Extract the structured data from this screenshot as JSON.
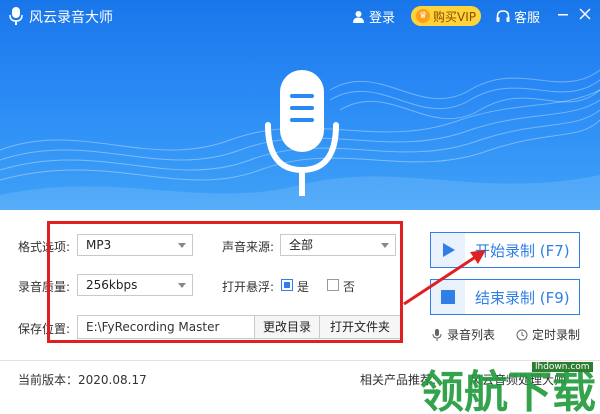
{
  "titlebar": {
    "app_title": "风云录音大师",
    "login_label": "登录",
    "vip_label": "购买VIP",
    "service_label": "客服"
  },
  "settings": {
    "format_label": "格式选项:",
    "format_value": "MP3",
    "source_label": "声音来源:",
    "source_value": "全部",
    "quality_label": "录音质量:",
    "quality_value": "256kbps",
    "float_label": "打开悬浮:",
    "float_yes": "是",
    "float_no": "否",
    "float_selected": "是",
    "save_label": "保存位置:",
    "save_path": "E:\\FyRecording Master",
    "change_dir_label": "更改目录",
    "open_folder_label": "打开文件夹"
  },
  "actions": {
    "start_label": "开始录制 (F7)",
    "stop_label": "结束录制 (F9)",
    "list_label": "录音列表",
    "timer_label": "定时录制"
  },
  "footer": {
    "version_text": "当前版本：2020.08.17",
    "related_label": "相关产品推荐:",
    "related_app": "风云音频处理大师"
  },
  "watermark": {
    "text": "领航下载",
    "url": "lhdown.com"
  },
  "colors": {
    "accent": "#2f7fe6",
    "hero_top": "#1976ea",
    "vip": "#ffd43b",
    "highlight": "#e02020"
  }
}
